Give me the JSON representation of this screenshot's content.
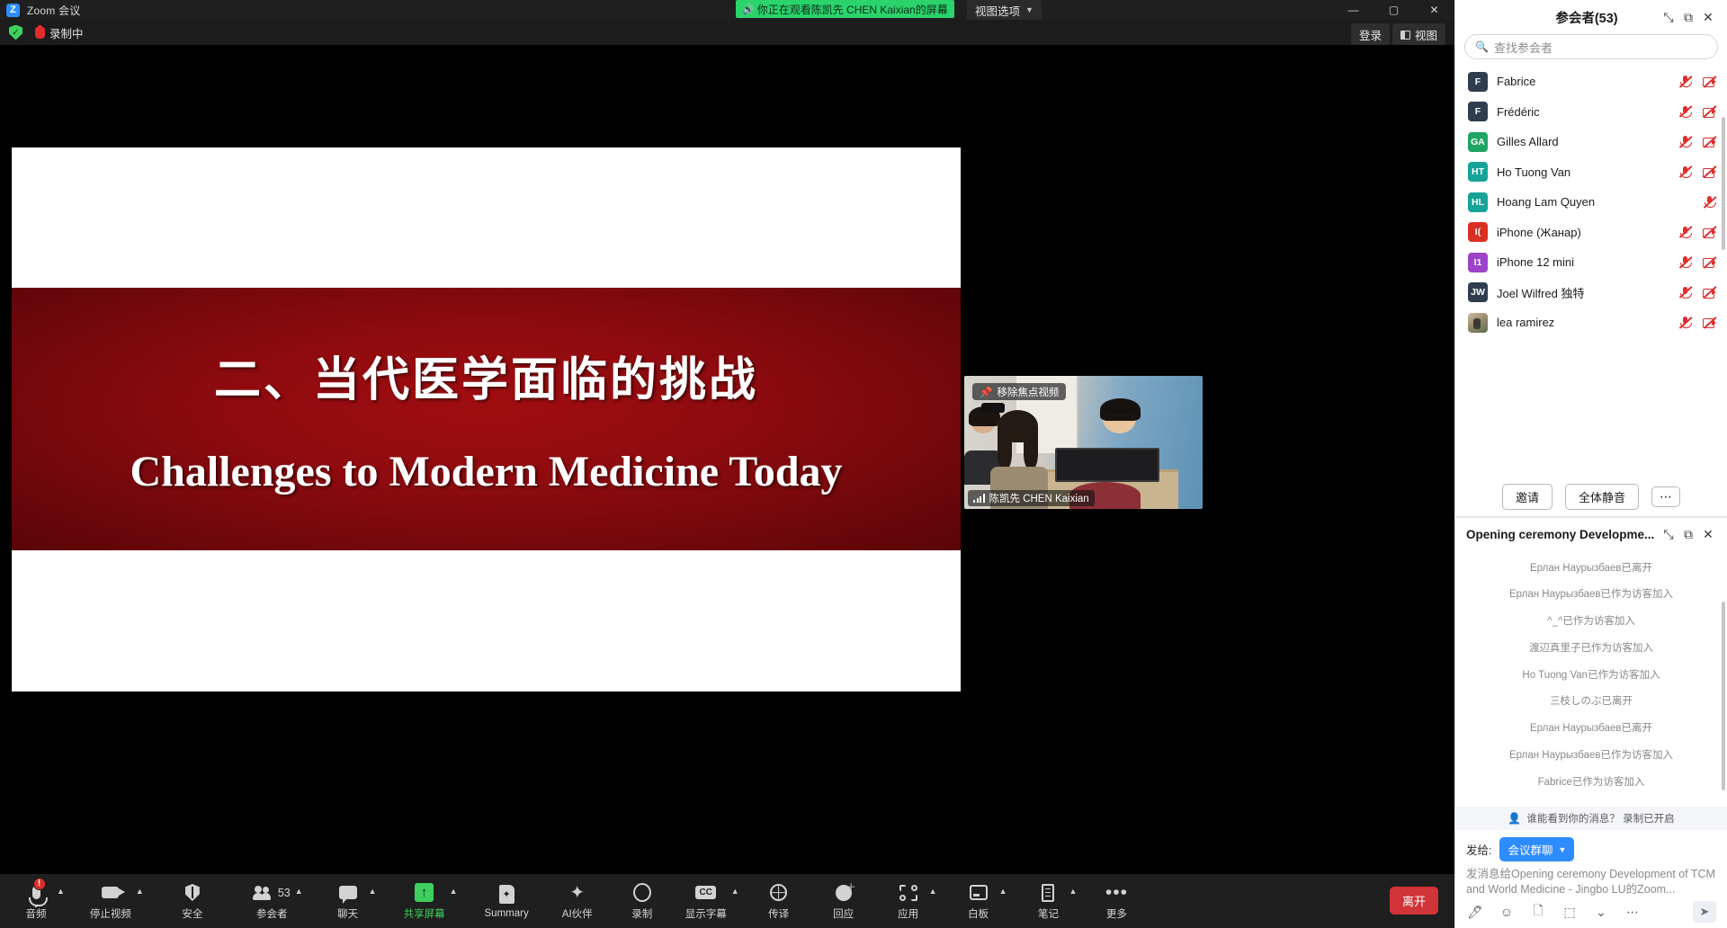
{
  "titlebar": {
    "app_title": "Zoom 会议",
    "logo_letter": "Z",
    "watching_banner": "你正在观看陈凯先 CHEN  Kaixian的屏幕",
    "view_options": "视图选项",
    "minimize": "—",
    "maximize": "▢",
    "close": "✕"
  },
  "topbar": {
    "recording_label": "录制中",
    "login_label": "登录",
    "view_label": "视图"
  },
  "slide": {
    "title_cn": "二、当代医学面临的挑战",
    "title_en": "Challenges to Modern Medicine Today"
  },
  "thumbnail": {
    "pin_label": "移除焦点视频",
    "speaker_name": "陈凯先 CHEN Kaixian"
  },
  "toolbar": {
    "items": [
      {
        "label": "音频",
        "icon": "microphone-icon",
        "caret": true,
        "badge": "!"
      },
      {
        "label": "停止视频",
        "icon": "camera-icon",
        "caret": true
      },
      {
        "label": "安全",
        "icon": "shield-icon",
        "caret": false
      },
      {
        "label": "参会者",
        "icon": "participants-icon",
        "caret": true,
        "count": "53"
      },
      {
        "label": "聊天",
        "icon": "chat-icon",
        "caret": true
      },
      {
        "label": "共享屏幕",
        "icon": "share-screen-icon",
        "caret": true,
        "active": true
      },
      {
        "label": "Summary",
        "icon": "summary-icon",
        "caret": false
      },
      {
        "label": "AI伙伴",
        "icon": "ai-sparkle-icon",
        "caret": false
      },
      {
        "label": "录制",
        "icon": "record-icon",
        "caret": false
      },
      {
        "label": "显示字幕",
        "icon": "closed-caption-icon",
        "caret": true
      },
      {
        "label": "传译",
        "icon": "globe-icon",
        "caret": false
      },
      {
        "label": "回应",
        "icon": "reactions-icon",
        "caret": false
      },
      {
        "label": "应用",
        "icon": "apps-icon",
        "caret": true
      },
      {
        "label": "白板",
        "icon": "whiteboard-icon",
        "caret": true
      },
      {
        "label": "笔记",
        "icon": "notes-icon",
        "caret": true
      },
      {
        "label": "更多",
        "icon": "more-icon",
        "caret": false
      }
    ],
    "leave_label": "离开"
  },
  "participants_panel": {
    "title": "参会者(53)",
    "search_placeholder": "查找参会者",
    "collapse_icon": "collapse-icon",
    "popout_icon": "popout-icon",
    "close_icon": "close-icon",
    "list": [
      {
        "name": "Fabrice",
        "initials": "F",
        "color": "#2f3d4f",
        "mic_muted": true,
        "cam_off": true
      },
      {
        "name": "Frédéric",
        "initials": "F",
        "color": "#2f3d4f",
        "mic_muted": true,
        "cam_off": true
      },
      {
        "name": "Gilles Allard",
        "initials": "GA",
        "color": "#1fa463",
        "mic_muted": true,
        "cam_off": true
      },
      {
        "name": "Ho Tuong Van",
        "initials": "HT",
        "color": "#17a398",
        "mic_muted": true,
        "cam_off": true
      },
      {
        "name": "Hoang Lam Quyen",
        "initials": "HL",
        "color": "#17a398",
        "mic_muted": true,
        "cam_off": false
      },
      {
        "name": "iPhone (Жанар)",
        "initials": "I(",
        "color": "#d93025",
        "mic_muted": true,
        "cam_off": true
      },
      {
        "name": "iPhone 12 mini",
        "initials": "I1",
        "color": "#9c44c9",
        "mic_muted": true,
        "cam_off": true
      },
      {
        "name": "Joel Wilfred  独特",
        "initials": "JW",
        "color": "#2f3d4f",
        "mic_muted": true,
        "cam_off": true
      },
      {
        "name": "lea ramirez",
        "initials": "",
        "color": "photo",
        "mic_muted": true,
        "cam_off": true
      }
    ],
    "actions": {
      "invite": "邀请",
      "mute_all": "全体静音",
      "more": "⋯"
    }
  },
  "chat_panel": {
    "title": "Opening ceremony Developme...",
    "collapse_icon": "collapse-icon",
    "popout_icon": "popout-icon",
    "close_icon": "close-icon",
    "messages": [
      "Ерлан Наурызбаев已离开",
      "Ерлан Наурызбаев已作为访客加入",
      "^_^已作为访客加入",
      "渡辺真里子已作为访客加入",
      "Ho Tuong Van已作为访客加入",
      "三枝しのぶ已离开",
      "Ерлан Наурызбаев已离开",
      "Ерлан Наурызбаев已作为访客加入",
      "Fabrice已作为访客加入"
    ],
    "notice": "谁能看到你的消息？ 录制已开启",
    "to_label": "发给:",
    "to_target": "会议群聊",
    "input_placeholder": "发消息给Opening ceremony Development of TCM and World Medicine - Jingbo LU的Zoom...",
    "tools": [
      {
        "icon": "format-text-icon",
        "glyph": "🖊"
      },
      {
        "icon": "emoji-icon",
        "glyph": "☺"
      },
      {
        "icon": "file-icon",
        "glyph": "🗋"
      },
      {
        "icon": "screenshot-icon",
        "glyph": "⬚"
      },
      {
        "icon": "chevron-down-icon",
        "glyph": "⌄"
      },
      {
        "icon": "more-options-icon",
        "glyph": "⋯"
      }
    ],
    "send_icon": "send-icon"
  }
}
